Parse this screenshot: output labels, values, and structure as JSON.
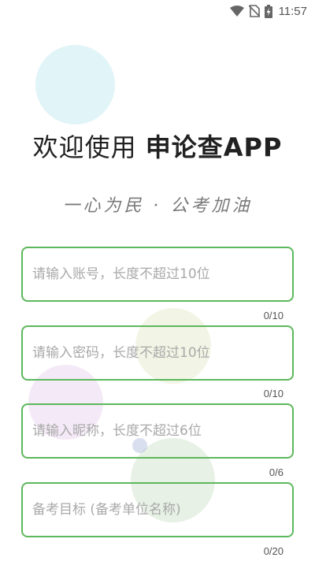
{
  "status_bar": {
    "time": "11:57",
    "icons": [
      "wifi-icon",
      "no-sim-icon",
      "battery-charging-icon"
    ]
  },
  "header": {
    "welcome_text": "欢迎使用 ",
    "app_name": "申论查APP",
    "slogan": "一心为民 · 公考加油"
  },
  "form": {
    "account": {
      "placeholder": "请输入账号，长度不超过10位",
      "value": "",
      "counter": "0/10"
    },
    "password": {
      "placeholder": "请输入密码，长度不超过10位",
      "value": "",
      "counter": "0/10"
    },
    "nickname": {
      "placeholder": "请输入昵称，长度不超过6位",
      "value": "",
      "counter": "0/6"
    },
    "goal": {
      "placeholder": "备考目标 (备考单位名称)",
      "value": "",
      "counter": "0/20"
    }
  },
  "colors": {
    "accent_border": "#5cb85c",
    "placeholder": "#a9a9a9",
    "title": "#212121",
    "slogan": "#7a7a7a"
  }
}
